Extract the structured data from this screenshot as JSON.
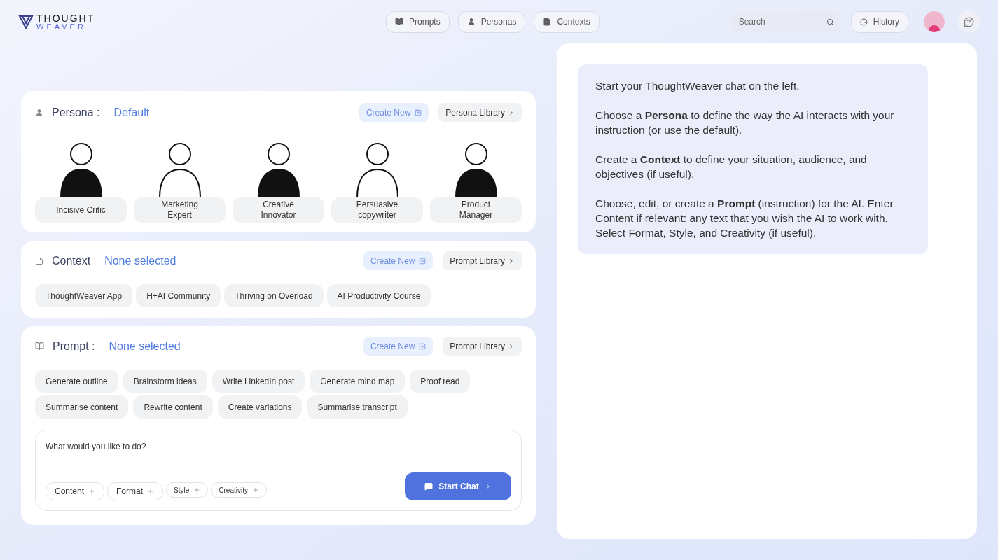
{
  "logo": {
    "line1": "THOUGHT",
    "line2": "WEAVER"
  },
  "nav": [
    {
      "label": "Prompts"
    },
    {
      "label": "Personas"
    },
    {
      "label": "Contexts"
    }
  ],
  "search": {
    "placeholder": "Search"
  },
  "history": {
    "label": "History"
  },
  "persona": {
    "title": "Persona :",
    "value": "Default",
    "create": "Create New",
    "library": "Persona Library",
    "items": [
      {
        "name": "Incisive Critic"
      },
      {
        "name": "Marketing Expert"
      },
      {
        "name": "Creative Innovator"
      },
      {
        "name": "Persuasive copywriter"
      },
      {
        "name": "Product Manager"
      }
    ]
  },
  "context": {
    "title": "Context",
    "value": "None selected",
    "create": "Create New",
    "library": "Prompt Library",
    "items": [
      "ThoughtWeaver App",
      "H+AI Community",
      "Thriving on Overload",
      "AI Productivity Course"
    ]
  },
  "prompt": {
    "title": "Prompt :",
    "value": "None selected",
    "create": "Create New",
    "library": "Prompt Library",
    "items": [
      "Generate outline",
      "Brainstorm ideas",
      "Write LinkedIn post",
      "Generate mind map",
      "Proof read",
      "Summarise content",
      "Rewrite content",
      "Create variations",
      "Summarise transcript"
    ],
    "input_placeholder": "What would you like to do?",
    "options": [
      {
        "label": "Content"
      },
      {
        "label": "Format"
      },
      {
        "label": "Style"
      },
      {
        "label": "Creativity"
      }
    ],
    "start": "Start Chat"
  },
  "help": [
    "Start your ThoughtWeaver chat on the left.",
    "Choose a **Persona** to define the way the AI interacts with your instruction (or use the default).",
    "Create a **Context** to define your situation, audience, and objectives (if useful).",
    "Choose, edit, or create a **Prompt** (instruction) for the AI. Enter Content if relevant: any text that you wish the AI to work with. Select Format, Style, and Creativity (if useful)."
  ]
}
